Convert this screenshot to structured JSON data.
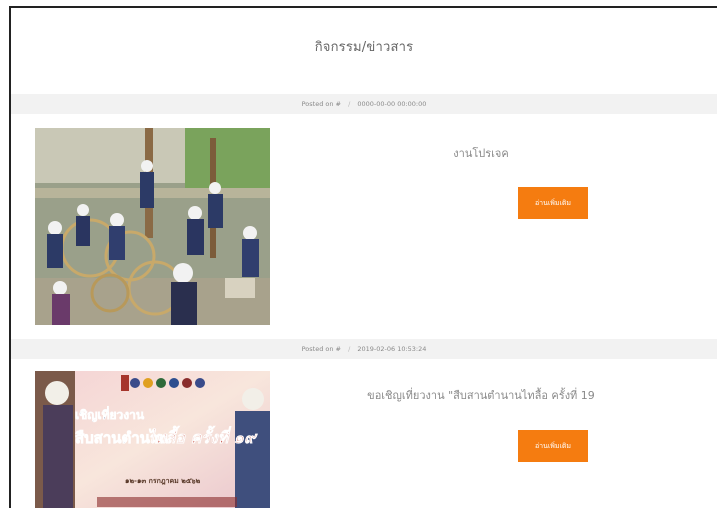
{
  "page": {
    "title": "กิจกรรม/ข่าวสาร"
  },
  "posts": [
    {
      "meta": {
        "posted_on_label": "Posted on #",
        "separator": "/",
        "date": "0000-00-00 00:00:00"
      },
      "title": "งานโปรเจค",
      "read_more_label": "อ่านเพิ่มเติม",
      "image_icon": "weaving-activity-photo"
    },
    {
      "meta": {
        "posted_on_label": "Posted on #",
        "separator": "/",
        "date": "2019-02-06 10:53:24"
      },
      "title": "ขอเชิญเที่ยวงาน \"สืบสานตำนานไทลื้อ ครั้งที่ 19",
      "read_more_label": "อ่านเพิ่มเติม",
      "image_icon": "festival-poster",
      "poster": {
        "line1": "เชิญเที่ยวงาน",
        "line2": "สืบสานตำนาน",
        "line3": "ไทลื้อ ครั้งที่ ๑๙",
        "date_text": "๑๒-๑๓ กรกฎาคม ๒๕๖๒"
      }
    }
  ],
  "colors": {
    "accent": "#f57c10",
    "meta_bar": "#f2f2f2"
  }
}
